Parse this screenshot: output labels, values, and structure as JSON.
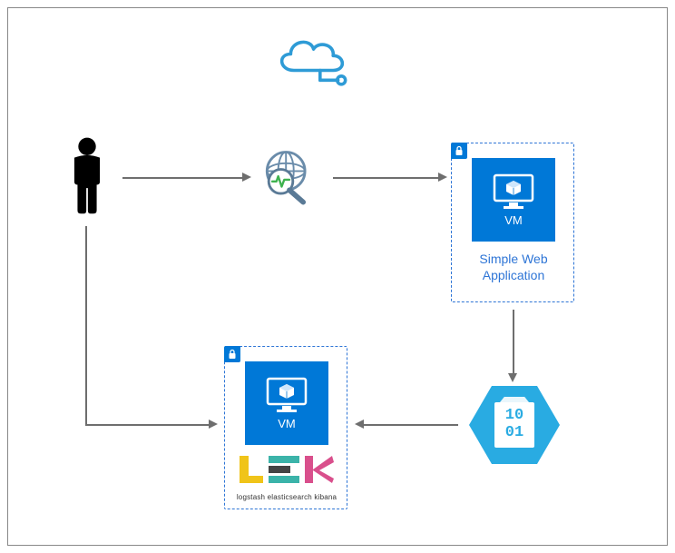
{
  "nodes": {
    "cloud": {
      "name": "cloud-icon"
    },
    "user": {
      "name": "user-icon"
    },
    "web_search": {
      "name": "web-search-icon"
    },
    "vm1": {
      "label": "VM",
      "caption": "Simple Web Application"
    },
    "vm2": {
      "label": "VM"
    },
    "data": {
      "name": "data-hexagon",
      "bits_top": "10",
      "bits_bottom": "01"
    },
    "elk": {
      "sub_l": "logstash",
      "sub_e": "elasticsearch",
      "sub_k": "kibana"
    }
  },
  "arrows": [
    {
      "from": "user",
      "to": "web_search"
    },
    {
      "from": "web_search",
      "to": "vm1"
    },
    {
      "from": "vm1",
      "to": "data"
    },
    {
      "from": "data",
      "to": "vm2"
    },
    {
      "from": "user",
      "to": "vm2"
    }
  ]
}
